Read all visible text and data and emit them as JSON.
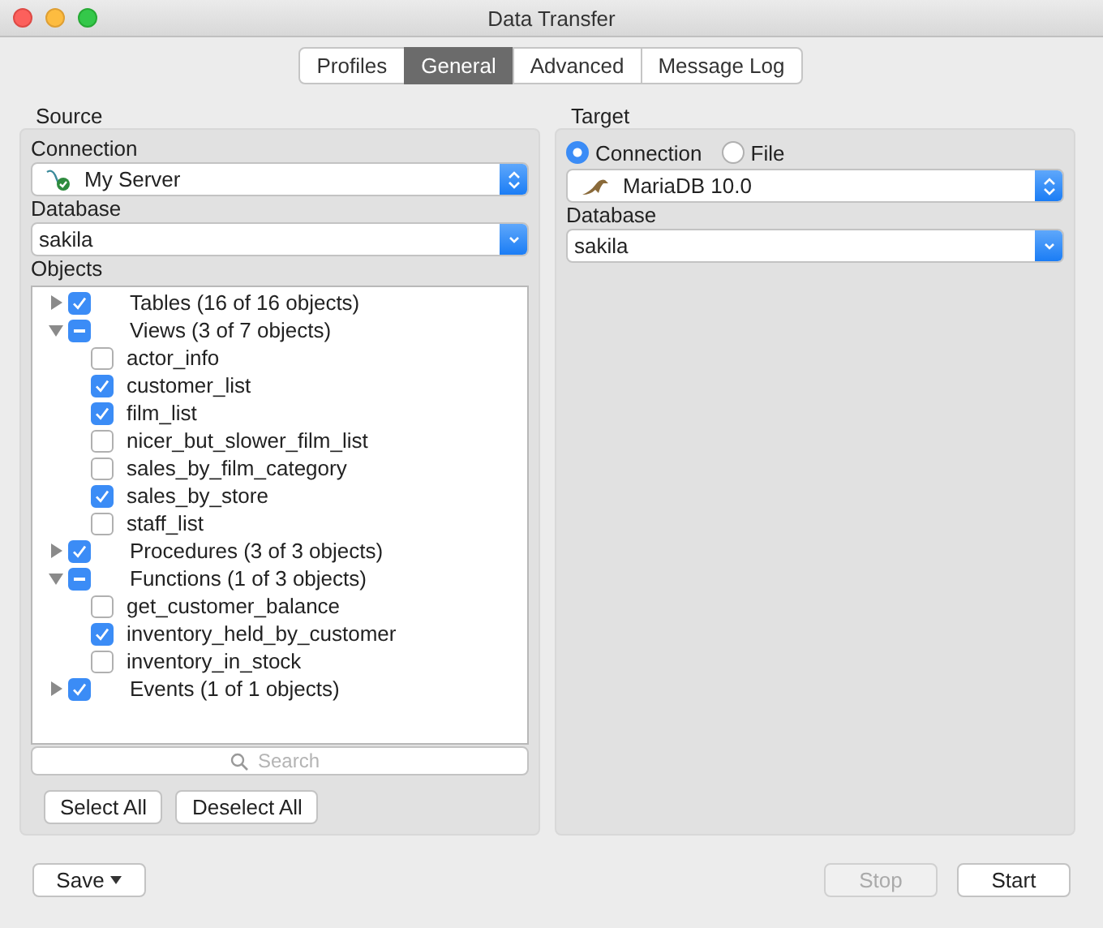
{
  "window": {
    "title": "Data Transfer"
  },
  "tabs": [
    {
      "label": "Profiles",
      "selected": false
    },
    {
      "label": "General",
      "selected": true
    },
    {
      "label": "Advanced",
      "selected": false
    },
    {
      "label": "Message Log",
      "selected": false
    }
  ],
  "source": {
    "title": "Source",
    "connection_label": "Connection",
    "connection": "My Server",
    "database_label": "Database",
    "database": "sakila",
    "objects_label": "Objects",
    "objects": [
      {
        "label": "Tables (16 of 16 objects)",
        "checked": true,
        "mixed": false,
        "expanded": false
      },
      {
        "label": "Views (3 of 7 objects)",
        "checked": true,
        "mixed": true,
        "expanded": true,
        "children": [
          {
            "label": "actor_info",
            "checked": false
          },
          {
            "label": "customer_list",
            "checked": true
          },
          {
            "label": "film_list",
            "checked": true
          },
          {
            "label": "nicer_but_slower_film_list",
            "checked": false
          },
          {
            "label": "sales_by_film_category",
            "checked": false
          },
          {
            "label": "sales_by_store",
            "checked": true
          },
          {
            "label": "staff_list",
            "checked": false
          }
        ]
      },
      {
        "label": "Procedures (3 of 3 objects)",
        "checked": true,
        "mixed": false,
        "expanded": false
      },
      {
        "label": "Functions (1 of 3 objects)",
        "checked": true,
        "mixed": true,
        "expanded": true,
        "children": [
          {
            "label": "get_customer_balance",
            "checked": false
          },
          {
            "label": "inventory_held_by_customer",
            "checked": true
          },
          {
            "label": "inventory_in_stock",
            "checked": false
          }
        ]
      },
      {
        "label": "Events (1 of 1 objects)",
        "checked": true,
        "mixed": false,
        "expanded": false
      }
    ],
    "search": {
      "placeholder": "Search"
    },
    "buttons": [
      "Select All",
      "Deselect All"
    ]
  },
  "target": {
    "title": "Target",
    "modes": [
      {
        "label": "Connection",
        "selected": true
      },
      {
        "label": "File",
        "selected": false
      }
    ],
    "connection": "MariaDB 10.0",
    "database_label": "Database",
    "database": "sakila"
  },
  "footer": {
    "save": "Save",
    "stop": {
      "label": "Stop",
      "disabled": true
    },
    "start": {
      "label": "Start",
      "disabled": false
    }
  }
}
